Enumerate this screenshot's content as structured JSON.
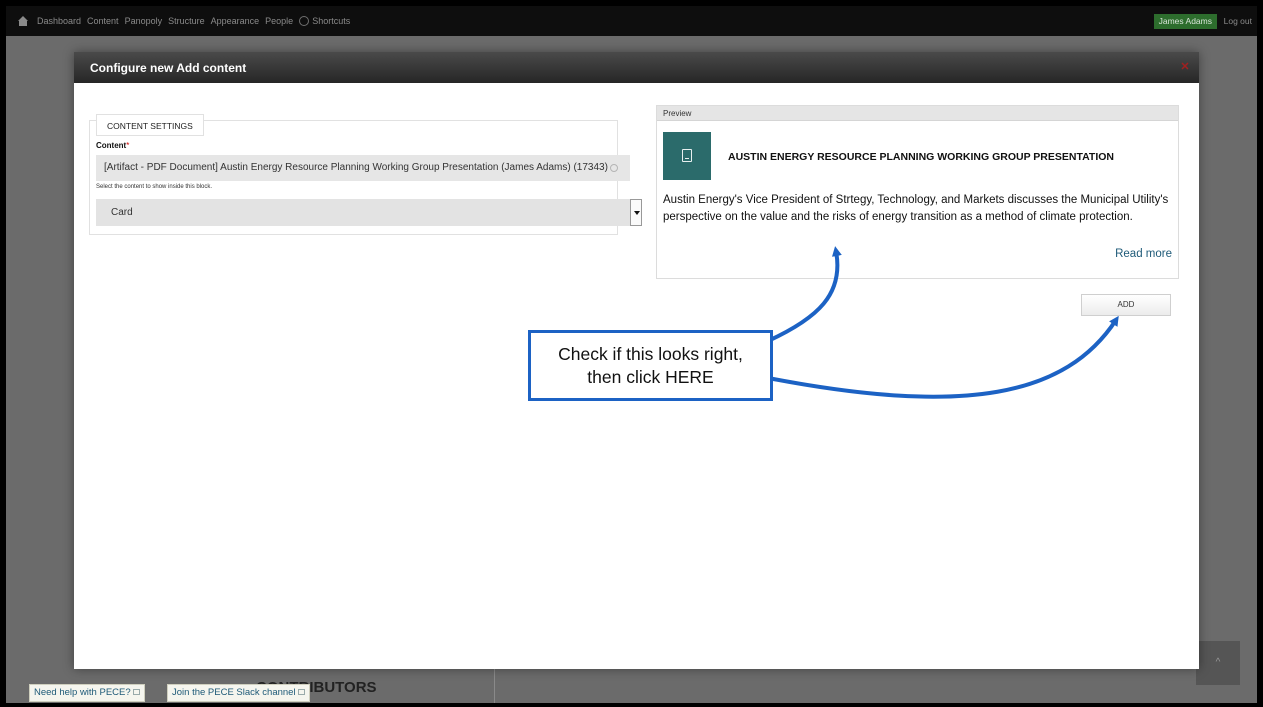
{
  "toolbar": {
    "items": [
      "Dashboard",
      "Content",
      "Panopoly",
      "Structure",
      "Appearance",
      "People"
    ],
    "shortcuts": "Shortcuts",
    "user": "James Adams",
    "logout": "Log out"
  },
  "background": {
    "heading": "CONTRIBUTORS",
    "help_button": "Need help with PECE?",
    "slack_button": "Join the PECE Slack channel",
    "back_to_top": "^"
  },
  "modal": {
    "title": "Configure new Add content",
    "close": "✕",
    "settings": {
      "legend": "CONTENT SETTINGS",
      "content_label": "Content",
      "required_mark": "*",
      "content_value": "[Artifact - PDF Document] Austin Energy Resource Planning Working Group Presentation (James Adams) (17343)",
      "help_text": "Select the content to show inside this block.",
      "view_mode": "Card"
    },
    "preview": {
      "header": "Preview",
      "icon": "pdf-file-icon",
      "card_title": "AUSTIN ENERGY RESOURCE PLANNING WORKING GROUP PRESENTATION",
      "card_body": "Austin Energy's Vice President of Strtegy, Technology, and Markets discusses the Municipal Utility's perspective on the value and the risks of energy transition as a method of climate protection.",
      "read_more": "Read more"
    },
    "add_button": "ADD"
  },
  "annotation": {
    "line1": "Check if this looks right,",
    "line2": "then click HERE",
    "color": "#1c62c4"
  }
}
